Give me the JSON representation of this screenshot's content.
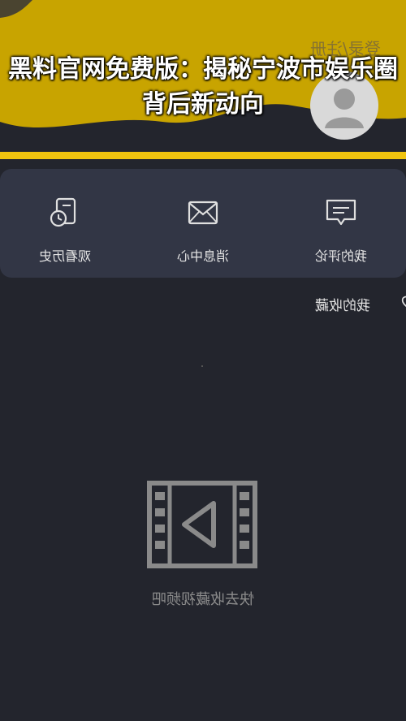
{
  "header": {
    "login_label": "登录/注册",
    "title": "黑料官网免费版：揭秘宁波市娱乐圈背后新动向"
  },
  "menu": [
    {
      "label": "观看历史",
      "icon": "clock-document-icon"
    },
    {
      "label": "消息中心",
      "icon": "envelope-icon"
    },
    {
      "label": "我的评论",
      "icon": "comment-icon"
    }
  ],
  "favorites": {
    "label": "我的收藏",
    "icon": "heart-icon",
    "empty_text": "快去收藏视频吧",
    "empty_icon": "video-film-icon"
  },
  "colors": {
    "header_bg": "#c8a400",
    "accent_bar": "#f1c40f",
    "page_bg": "#23252d",
    "card_bg": "#323645"
  }
}
